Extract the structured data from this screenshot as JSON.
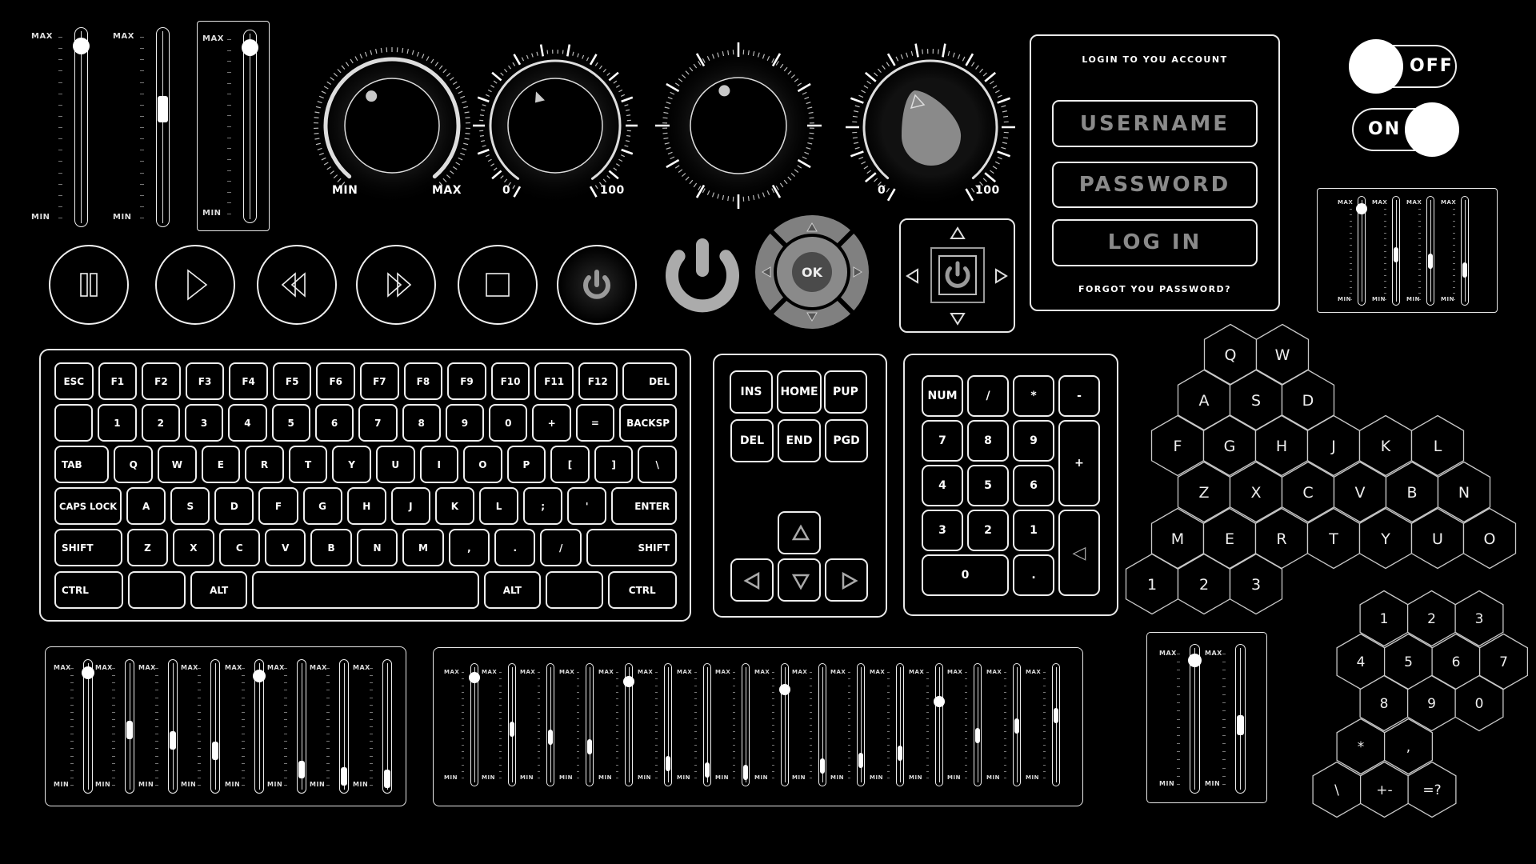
{
  "colors": {
    "background": "#000000",
    "line": "#eeeeee",
    "muted": "#8a8a8a",
    "control_gray": "#7f7f7f",
    "ok_center": "#4a4a4a"
  },
  "top_sliders": {
    "labels": {
      "max": "MAX",
      "min": "MIN"
    },
    "sliders": [
      {
        "value": 0.95,
        "knob": "round"
      },
      {
        "value": 0.6,
        "knob": "square"
      },
      {
        "value": 0.95,
        "knob": "round",
        "framed": true
      }
    ]
  },
  "knobs": [
    {
      "min_label": "MIN",
      "max_label": "MAX",
      "pointer": "dot"
    },
    {
      "min_label": "0",
      "max_label": "100",
      "pointer": "triangle"
    },
    {
      "pointer": "dot"
    },
    {
      "min_label": "0",
      "max_label": "100",
      "pointer": "drop"
    }
  ],
  "media_buttons": [
    {
      "icon": "pause-icon",
      "name": "pause-button"
    },
    {
      "icon": "play-icon",
      "name": "play-button"
    },
    {
      "icon": "rewind-icon",
      "name": "rewind-button"
    },
    {
      "icon": "fast-forward-icon",
      "name": "fast-forward-button"
    },
    {
      "icon": "stop-icon",
      "name": "stop-button"
    },
    {
      "icon": "power-icon",
      "name": "power-button"
    }
  ],
  "dpad": {
    "ok_label": "OK"
  },
  "login": {
    "title": "LOGIN TO YOU ACCOUNT",
    "username_placeholder": "USERNAME",
    "password_placeholder": "PASSWORD",
    "login_label": "LOG IN",
    "forgot_label": "FORGOT YOU PASSWORD?"
  },
  "toggles": [
    {
      "label": "OFF",
      "state": false
    },
    {
      "label": "ON",
      "state": true
    }
  ],
  "mixers": {
    "top_right": {
      "labels": {
        "max": "MAX",
        "min": "MIN"
      },
      "sliders": [
        {
          "value": 0.93,
          "knob": "round"
        },
        {
          "value": 0.46,
          "knob": "square"
        },
        {
          "value": 0.39,
          "knob": "square"
        },
        {
          "value": 0.3,
          "knob": "square"
        }
      ]
    },
    "bottom_left": {
      "labels": {
        "max": "MAX",
        "min": "MIN"
      },
      "sliders": [
        {
          "value": 0.96,
          "knob": "round"
        },
        {
          "value": 0.47,
          "knob": "square"
        },
        {
          "value": 0.38,
          "knob": "square"
        },
        {
          "value": 0.29,
          "knob": "square"
        },
        {
          "value": 0.93,
          "knob": "round"
        },
        {
          "value": 0.13,
          "knob": "square"
        },
        {
          "value": 0.07,
          "knob": "square"
        },
        {
          "value": 0.05,
          "knob": "square"
        }
      ]
    },
    "bottom_center": {
      "labels": {
        "max": "MAX",
        "min": "MIN"
      },
      "sliders": [
        {
          "value": 0.95,
          "knob": "round"
        },
        {
          "value": 0.46,
          "knob": "square"
        },
        {
          "value": 0.38,
          "knob": "square"
        },
        {
          "value": 0.29,
          "knob": "square"
        },
        {
          "value": 0.91,
          "knob": "round"
        },
        {
          "value": 0.13,
          "knob": "square"
        },
        {
          "value": 0.07,
          "knob": "square"
        },
        {
          "value": 0.05,
          "knob": "square"
        },
        {
          "value": 0.83,
          "knob": "round"
        },
        {
          "value": 0.11,
          "knob": "square"
        },
        {
          "value": 0.16,
          "knob": "square"
        },
        {
          "value": 0.23,
          "knob": "square"
        },
        {
          "value": 0.72,
          "knob": "round"
        },
        {
          "value": 0.4,
          "knob": "square"
        },
        {
          "value": 0.49,
          "knob": "square"
        },
        {
          "value": 0.59,
          "knob": "square"
        }
      ]
    },
    "bottom_right": {
      "labels": {
        "max": "MAX",
        "min": "MIN"
      },
      "sliders": [
        {
          "value": 0.95,
          "knob": "round"
        },
        {
          "value": 0.45,
          "knob": "square"
        }
      ]
    }
  },
  "keyboard": {
    "rows": [
      [
        "ESC",
        "F1",
        "F2",
        "F3",
        "F4",
        "F5",
        "F6",
        "F7",
        "F8",
        "F9",
        "F10",
        "F11",
        "F12",
        "DEL"
      ],
      [
        "",
        "1",
        "2",
        "3",
        "4",
        "5",
        "6",
        "7",
        "8",
        "9",
        "0",
        "+",
        "=",
        "BACKSP"
      ],
      [
        "TAB",
        "Q",
        "W",
        "E",
        "R",
        "T",
        "Y",
        "U",
        "I",
        "O",
        "P",
        "[",
        "]",
        "\\"
      ],
      [
        "CAPS LOCK",
        "A",
        "S",
        "D",
        "F",
        "G",
        "H",
        "J",
        "K",
        "L",
        ";",
        "'",
        "ENTER"
      ],
      [
        "SHIFT",
        "Z",
        "X",
        "C",
        "V",
        "B",
        "N",
        "M",
        ",",
        ".",
        "/",
        "SHIFT"
      ],
      [
        "CTRL",
        "",
        "ALT",
        "",
        "ALT",
        "",
        "CTRL"
      ]
    ]
  },
  "nav_cluster": {
    "keys": [
      "INS",
      "HOME",
      "PUP",
      "DEL",
      "END",
      "PGD"
    ],
    "arrows": [
      "up",
      "left",
      "down",
      "right"
    ]
  },
  "numpad": {
    "keys": [
      "NUM",
      "/",
      "*",
      "-",
      "7",
      "8",
      "9",
      "+",
      "4",
      "5",
      "6",
      "3",
      "2",
      "1",
      "◁",
      "0",
      "."
    ]
  },
  "hex_alpha": {
    "rows": [
      [
        "Q",
        "W"
      ],
      [
        "A",
        "S",
        "D"
      ],
      [
        "F",
        "G",
        "H",
        "J",
        "K",
        "L"
      ],
      [
        "Z",
        "X",
        "C",
        "V",
        "B",
        "N"
      ],
      [
        "M",
        "E",
        "R",
        "T",
        "Y",
        "U",
        "O"
      ],
      [
        "1",
        "2",
        "3"
      ]
    ]
  },
  "hex_numeric": {
    "rows": [
      [
        "1",
        "2",
        "3"
      ],
      [
        "4",
        "5",
        "6",
        "7"
      ],
      [
        "8",
        "9",
        "0"
      ],
      [
        "*",
        ","
      ],
      [
        "\\",
        "+-",
        "=?"
      ]
    ]
  }
}
